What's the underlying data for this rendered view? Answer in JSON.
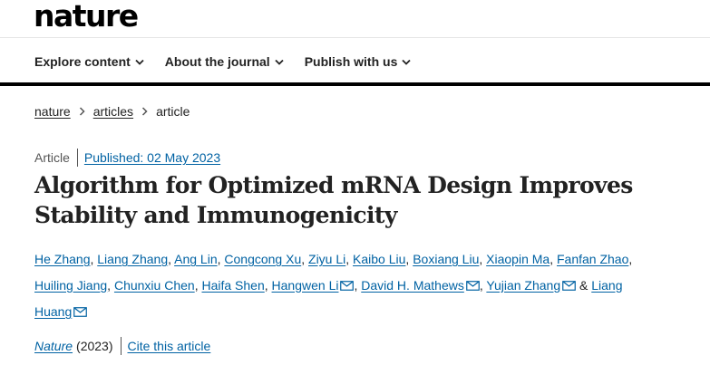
{
  "site": {
    "logo": "nature"
  },
  "nav": {
    "items": [
      {
        "label": "Explore content",
        "icon": "chevron-down-icon"
      },
      {
        "label": "About the journal",
        "icon": "chevron-down-icon"
      },
      {
        "label": "Publish with us",
        "icon": "chevron-down-icon"
      }
    ]
  },
  "breadcrumb": {
    "items": [
      "nature",
      "articles",
      "article"
    ]
  },
  "article": {
    "type": "Article",
    "published": "Published: 02 May 2023",
    "title": "Algorithm for Optimized mRNA Design Improves Stability and Immunogenicity",
    "authors": [
      "He Zhang",
      "Liang Zhang",
      "Ang Lin",
      "Congcong Xu",
      "Ziyu Li",
      "Kaibo Liu",
      "Boxiang Liu",
      "Xiaopin Ma",
      "Fanfan Zhao",
      "Huiling Jiang",
      "Chunxiu Chen",
      "Haifa Shen",
      "Hangwen Li",
      "David H. Mathews",
      "Yujian Zhang",
      "Liang Huang"
    ],
    "ampersand": "&",
    "journal": "Nature",
    "year": "(2023)",
    "cite_label": "Cite this article"
  },
  "colors": {
    "link": "#0062a3",
    "text": "#222222",
    "rule": "#000000"
  }
}
